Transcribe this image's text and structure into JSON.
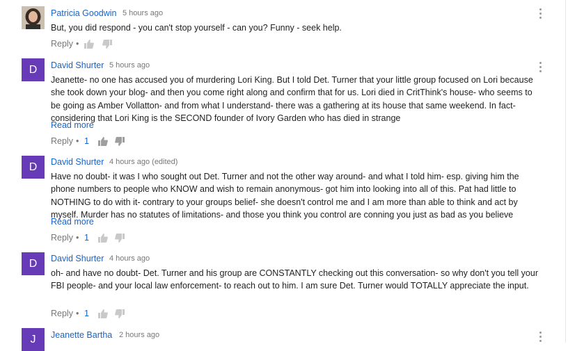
{
  "colors": {
    "link": "#1a64c8",
    "avatar_bg": "#673ab7",
    "meta": "#777777"
  },
  "icons": {
    "like": "thumbs-up-icon",
    "dislike": "thumbs-down-icon",
    "menu": "more-vertical-icon"
  },
  "comments": [
    {
      "author": "Patricia Goodwin",
      "time": "5 hours ago",
      "avatar": "photo",
      "text": "But, you did respond - you can't stop yourself - can you?  Funny - seek help.",
      "reply_label": "Reply",
      "dot": "•"
    },
    {
      "author": "David Shurter",
      "time": "5 hours ago",
      "avatar": "D",
      "text": "Jeanette- no one has accused you of murdering Lori King.  But I told Det. Turner that your little group focused on Lori because she took down your blog- and then you come right along and confirm that for us.  Lori died in CritThink's house- who seems to be going as Amber Vollatton- and from what I understand- there was a gathering at its house that same weekend.  In fact- considering that Lori King is the SECOND founder of Ivory Garden who has died in strange",
      "read_more": "Read more",
      "reply_label": "Reply",
      "dot": "•",
      "likes": "1"
    },
    {
      "author": "David Shurter",
      "time": "4 hours ago (edited)",
      "avatar": "D",
      "text": "Have no doubt- it was I who sought out Det. Turner and not the other way around- and what I told him- esp. giving him the phone numbers to people who KNOW and wish to remain anonymous- got him into looking into all of this.  Pat had little to NOTHING to do with it- contrary to your groups belief- she doesn't control me and I am more than able to think and act by myself.  Murder has no statutes of limitations- and those you think you control are conning you just as bad as you believe",
      "read_more": "Read more",
      "reply_label": "Reply",
      "dot": "•",
      "likes": "1"
    },
    {
      "author": "David Shurter",
      "time": "4 hours ago",
      "avatar": "D",
      "text": "oh- and have no doubt- Det. Turner and his group are CONSTANTLY checking out this conversation- so why don't you tell your FBI people- and your local law enforcement- to reach out to him.  I am sure Det. Turner would TOTALLY appreciate the input.",
      "reply_label": "Reply",
      "dot": "•",
      "likes": "1"
    },
    {
      "author": "Jeanette Bartha",
      "time": "2 hours ago",
      "avatar": "J"
    }
  ]
}
